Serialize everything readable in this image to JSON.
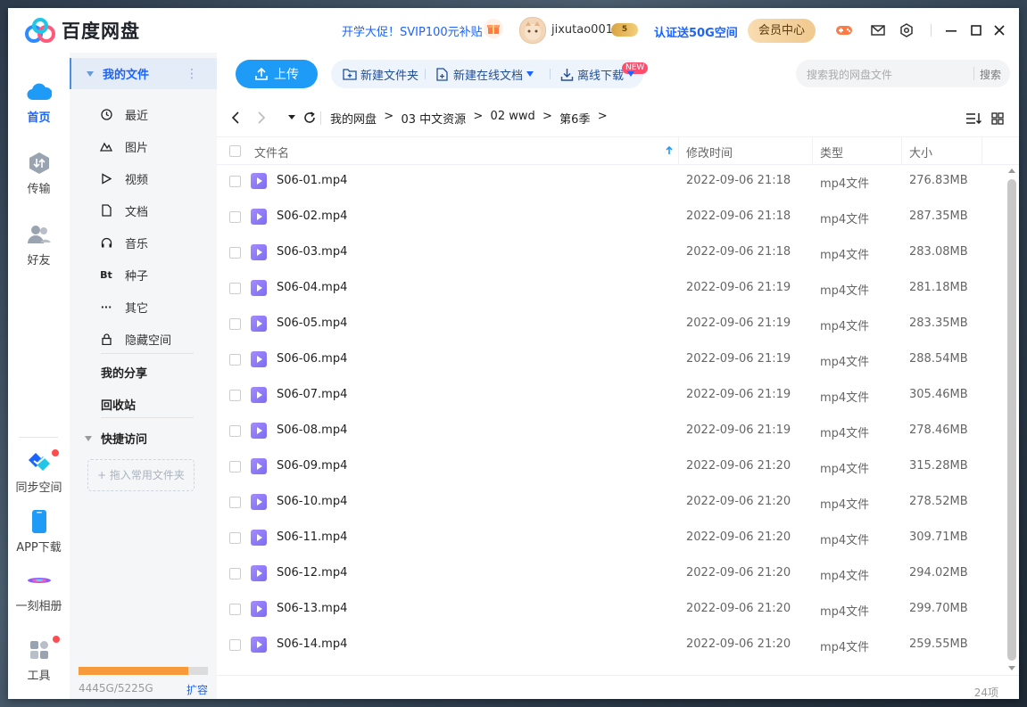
{
  "app": {
    "name": "百度网盘"
  },
  "header": {
    "promo": "开学大促！SVIP100元补贴",
    "username": "jixutao001",
    "vip_level": "5",
    "verify": "认证送50G空间",
    "member_center": "会员中心"
  },
  "leftnav": [
    {
      "label": "首页",
      "icon": "cloud-icon",
      "active": true
    },
    {
      "label": "传输",
      "icon": "transfer-icon"
    },
    {
      "label": "好友",
      "icon": "friends-icon"
    },
    {
      "label": "同步空间",
      "icon": "sync-icon"
    },
    {
      "label": "APP下载",
      "icon": "phone-icon"
    },
    {
      "label": "一刻相册",
      "icon": "album-icon"
    },
    {
      "label": "工具",
      "icon": "tools-icon"
    }
  ],
  "sidebar": {
    "my_files": "我的文件",
    "items": [
      {
        "label": "最近",
        "icon": "clock-icon"
      },
      {
        "label": "图片",
        "icon": "image-icon"
      },
      {
        "label": "视频",
        "icon": "video-icon"
      },
      {
        "label": "文档",
        "icon": "doc-icon"
      },
      {
        "label": "音乐",
        "icon": "headphones-icon"
      },
      {
        "label": "种子",
        "icon": "bt-icon",
        "glyph": "Bt"
      },
      {
        "label": "其它",
        "icon": "more-icon",
        "glyph": "···"
      },
      {
        "label": "隐藏空间",
        "icon": "lock-icon"
      }
    ],
    "my_share": "我的分享",
    "recycle": "回收站",
    "quick_access": "快捷访问",
    "drop_hint": "+ 拖入常用文件夹",
    "storage_text": "4445G/5225G",
    "storage_used_fraction": 0.851,
    "expand": "扩容"
  },
  "toolbar": {
    "upload": "上传",
    "new_folder": "新建文件夹",
    "new_doc": "新建在线文档",
    "new_badge": "NEW",
    "offline": "离线下载",
    "search_placeholder": "搜索我的网盘文件",
    "search_btn": "搜索"
  },
  "breadcrumb": [
    "我的网盘",
    "03 中文资源",
    "02 wwd",
    "第6季"
  ],
  "table": {
    "headers": {
      "name": "文件名",
      "time": "修改时间",
      "type": "类型",
      "size": "大小"
    },
    "rows": [
      {
        "name": "S06-01.mp4",
        "time": "2022-09-06 21:18",
        "type": "mp4文件",
        "size": "276.83MB"
      },
      {
        "name": "S06-02.mp4",
        "time": "2022-09-06 21:18",
        "type": "mp4文件",
        "size": "287.35MB"
      },
      {
        "name": "S06-03.mp4",
        "time": "2022-09-06 21:18",
        "type": "mp4文件",
        "size": "283.08MB"
      },
      {
        "name": "S06-04.mp4",
        "time": "2022-09-06 21:19",
        "type": "mp4文件",
        "size": "281.18MB"
      },
      {
        "name": "S06-05.mp4",
        "time": "2022-09-06 21:19",
        "type": "mp4文件",
        "size": "283.35MB"
      },
      {
        "name": "S06-06.mp4",
        "time": "2022-09-06 21:19",
        "type": "mp4文件",
        "size": "288.54MB"
      },
      {
        "name": "S06-07.mp4",
        "time": "2022-09-06 21:19",
        "type": "mp4文件",
        "size": "305.46MB"
      },
      {
        "name": "S06-08.mp4",
        "time": "2022-09-06 21:19",
        "type": "mp4文件",
        "size": "278.46MB"
      },
      {
        "name": "S06-09.mp4",
        "time": "2022-09-06 21:20",
        "type": "mp4文件",
        "size": "315.28MB"
      },
      {
        "name": "S06-10.mp4",
        "time": "2022-09-06 21:20",
        "type": "mp4文件",
        "size": "278.52MB"
      },
      {
        "name": "S06-11.mp4",
        "time": "2022-09-06 21:20",
        "type": "mp4文件",
        "size": "309.71MB"
      },
      {
        "name": "S06-12.mp4",
        "time": "2022-09-06 21:20",
        "type": "mp4文件",
        "size": "294.02MB"
      },
      {
        "name": "S06-13.mp4",
        "time": "2022-09-06 21:20",
        "type": "mp4文件",
        "size": "299.70MB"
      },
      {
        "name": "S06-14.mp4",
        "time": "2022-09-06 21:20",
        "type": "mp4文件",
        "size": "259.55MB"
      }
    ]
  },
  "footer": {
    "count": "24项"
  },
  "colors": {
    "accent": "#1b64ff",
    "upload": "#1e9bf7",
    "storage": "#f79a3c",
    "file_icon": "#8c7cf5"
  }
}
